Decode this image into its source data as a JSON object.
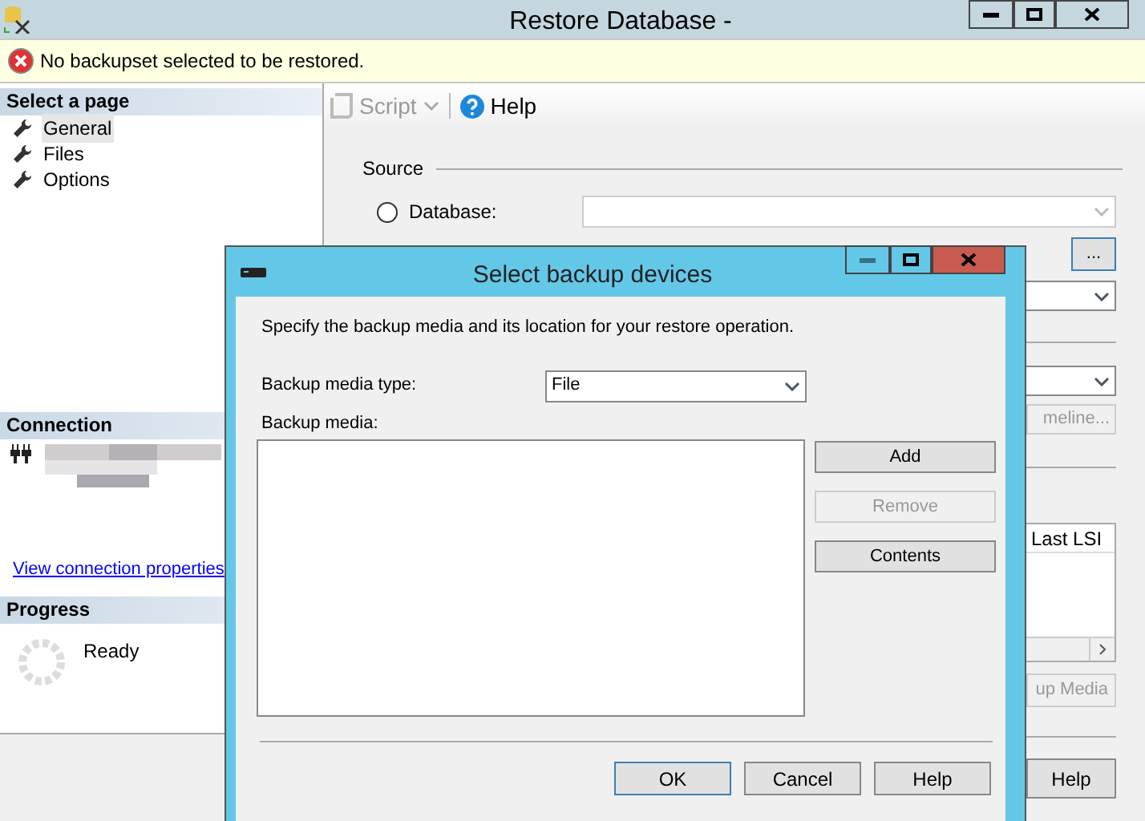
{
  "window": {
    "title": "Restore Database -"
  },
  "message": {
    "kind": "error",
    "text": "No backupset selected to be restored."
  },
  "sidebar": {
    "heading": "Select a page",
    "pages": [
      {
        "label": "General",
        "selected": true
      },
      {
        "label": "Files",
        "selected": false
      },
      {
        "label": "Options",
        "selected": false
      }
    ],
    "connection": {
      "heading": "Connection",
      "link": "View connection properties"
    },
    "progress": {
      "heading": "Progress",
      "status": "Ready"
    }
  },
  "toolbar": {
    "script": {
      "label": "Script",
      "disabled": true
    },
    "help": {
      "label": "Help",
      "disabled": false
    }
  },
  "source": {
    "heading": "Source",
    "options": [
      {
        "label": "Database:",
        "selected": false
      }
    ],
    "browse_button": "..."
  },
  "background_controls": {
    "timeline_button": "meline...",
    "column_header": "Last LSI",
    "media_button": "up Media",
    "help_button": "Help"
  },
  "dialog": {
    "title": "Select backup devices",
    "instruction": "Specify the backup media and its location for your restore operation.",
    "media_type_label": "Backup media type:",
    "media_type": "File",
    "media_label": "Backup media:",
    "side_buttons": [
      {
        "label": "Add",
        "disabled": false
      },
      {
        "label": "Remove",
        "disabled": true
      },
      {
        "label": "Contents",
        "disabled": false
      }
    ],
    "buttons": [
      {
        "label": "OK",
        "default": true
      },
      {
        "label": "Cancel",
        "default": false
      },
      {
        "label": "Help",
        "default": false
      }
    ]
  }
}
